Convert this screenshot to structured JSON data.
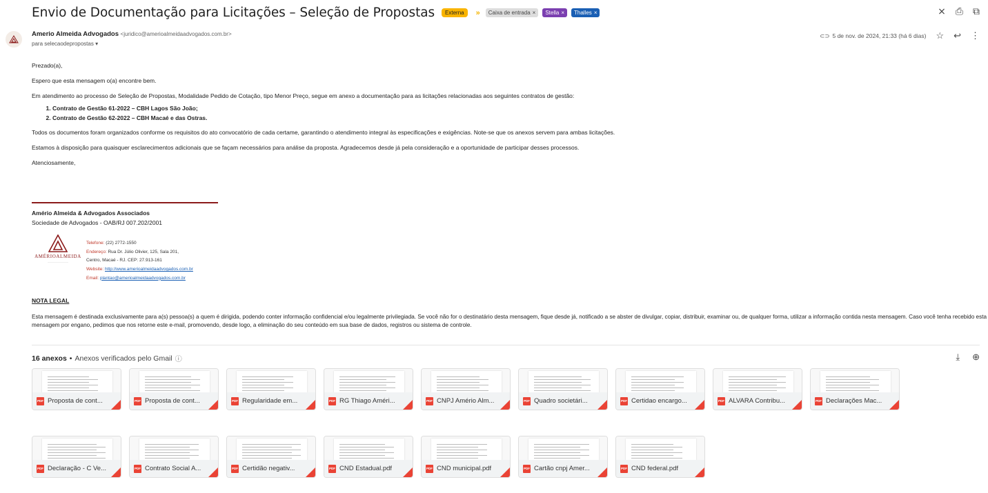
{
  "email": {
    "subject": "Envio de Documentação para Licitações – Seleção de Propostas",
    "badge": "Externa",
    "labels": [
      "Caixa de entrada",
      "Stella",
      "Thalles"
    ],
    "sender_name": "Amerio Almeida Advogados",
    "sender_email": "<juridico@amerioalmeidaadvogados.com.br>",
    "to": "para selecaodepropostas",
    "date": "5 de nov. de 2024, 21:33 (há 6 dias)"
  },
  "body": {
    "greeting": "Prezado(a),",
    "p1": "Espero que esta mensagem o(a) encontre bem.",
    "p2": "Em atendimento ao processo de Seleção de Propostas, Modalidade Pedido de Cotação, tipo Menor Preço, segue em anexo a documentação para as licitações relacionadas aos seguintes contratos de gestão:",
    "list": [
      "Contrato de Gestão 61-2022 – CBH Lagos São João;",
      "Contrato de Gestão 62-2022 – CBH Macaé e das Ostras."
    ],
    "p3": "Todos os documentos foram organizados conforme os requisitos do ato convocatório de cada certame, garantindo o atendimento integral às especificações e exigências. Note-se que os anexos servem para ambas licitações.",
    "p4": "Estamos à disposição para quaisquer esclarecimentos adicionais que se façam necessários para análise da proposta. Agradecemos desde já pela consideração e a oportunidade de participar desses processos.",
    "closing": "Atenciosamente,"
  },
  "signature": {
    "name": "Amério Almeida & Advogados Associados",
    "sub": "Sociedade de Advogados - OAB/RJ 007.202/2001",
    "logo_text": "AMÉRIOALMEIDA",
    "phone_k": "Telefone:",
    "phone_v": "(22) 2772-1550",
    "addr_k": "Endereço:",
    "addr_v": "Rua Dr. Júlio Olivier, 125, Sala 201,",
    "addr_v2": "Centro, Macaé - RJ. CEP: 27.913-161",
    "web_k": "Website:",
    "web_v": "http://www.amerioalmeidaadvogados.com.br",
    "mail_k": "Email:",
    "mail_v": "plantao@amerioalmeidaadvogados.com.br"
  },
  "nota": {
    "title": "NOTA LEGAL",
    "text": "Esta mensagem é destinada exclusivamente para a(s) pessoa(s) a quem é dirigida, podendo conter informação confidencial e/ou legalmente privilegiada. Se você não for o destinatário desta mensagem, fique desde já, notificado a se abster de divulgar, copiar, distribuir, examinar ou, de qualquer forma, utilizar a informação contida nesta mensagem. Caso você tenha recebido esta mensagem por engano, pedimos que nos retorne este e-mail, promovendo, desde logo, a eliminação do seu conteúdo em sua base de dados, registros ou sistema de controle."
  },
  "attachments": {
    "count_label": "16 anexos",
    "verified": "Anexos verificados pelo Gmail",
    "pdf_label": "PDF",
    "items": [
      "Proposta de cont...",
      "Proposta de cont...",
      "Regularidade em...",
      "RG Thiago Améri...",
      "CNPJ Amério Alm...",
      "Quadro societári...",
      "Certidao encargo...",
      "ALVARA Contribu...",
      "Declarações Mac...",
      "Declaração - C Ve...",
      "Contrato Social A...",
      "Certidão negativ...",
      "CND Estadual.pdf",
      "CND municipal.pdf",
      "Cartão cnpj Amer...",
      "CND federal.pdf"
    ]
  }
}
